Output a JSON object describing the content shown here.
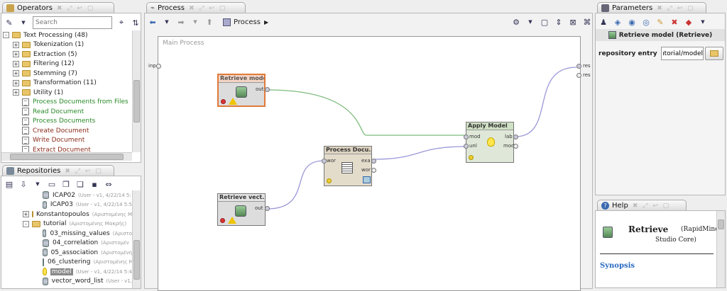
{
  "operators_panel": {
    "tab_label": "Operators",
    "search_placeholder": "Search",
    "tree": [
      {
        "label": "Text Processing (48)",
        "kind": "folder",
        "expander": "-"
      },
      {
        "label": "Tokenization (1)",
        "kind": "folder",
        "expander": "+"
      },
      {
        "label": "Extraction (5)",
        "kind": "folder",
        "expander": "+"
      },
      {
        "label": "Filtering (12)",
        "kind": "folder",
        "expander": "+"
      },
      {
        "label": "Stemming (7)",
        "kind": "folder",
        "expander": "+"
      },
      {
        "label": "Transformation (11)",
        "kind": "folder",
        "expander": "+"
      },
      {
        "label": "Utility (1)",
        "kind": "folder",
        "expander": "+"
      },
      {
        "label": "Process Documents from Files",
        "kind": "op-green"
      },
      {
        "label": "Read Document",
        "kind": "op-green"
      },
      {
        "label": "Process Documents",
        "kind": "op-green"
      },
      {
        "label": "Create Document",
        "kind": "op-brown"
      },
      {
        "label": "Write Document",
        "kind": "op-brown"
      },
      {
        "label": "Extract Document",
        "kind": "op-brown"
      }
    ]
  },
  "repositories_panel": {
    "tab_label": "Repositories",
    "tree": [
      {
        "label": "ICAP02",
        "sub": "(User - v1, 4/22/14 5:",
        "kind": "db"
      },
      {
        "label": "ICAP03",
        "sub": "(User - v1, 4/22/14 5:5",
        "kind": "db"
      },
      {
        "label": "Konstantopoulos",
        "sub": "(Αριστομένης Μ",
        "kind": "folder",
        "expander": "+"
      },
      {
        "label": "tutorial",
        "sub": "(Αριστομένης Μακρής)",
        "kind": "folder",
        "expander": "-"
      },
      {
        "label": "03_missing_values",
        "sub": "(Αριστο",
        "kind": "db"
      },
      {
        "label": "04_correlation",
        "sub": "(Αριστομέν",
        "kind": "db"
      },
      {
        "label": "05_association",
        "sub": "(Αριστομένη",
        "kind": "db"
      },
      {
        "label": "06_clustering",
        "sub": "(Αριστομένης Μ",
        "kind": "db"
      },
      {
        "label": "model",
        "sub": "(User - v1, 4/22/14 5:4",
        "kind": "bulb",
        "selected": true
      },
      {
        "label": "vector_word_list",
        "sub": "(User - v1,",
        "kind": "db"
      }
    ]
  },
  "process_panel": {
    "tab_label": "Process",
    "breadcrumb": "Process",
    "canvas_title": "Main Process",
    "left_port": "inp",
    "right_ports": [
      "res",
      "res"
    ],
    "operators": {
      "retrieve_model": {
        "title": "Retrieve model",
        "out": "out"
      },
      "retrieve_vect": {
        "title": "Retrieve vect...",
        "out": "out"
      },
      "process_docs": {
        "title": "Process Docu...",
        "in": "wor",
        "out1": "exa",
        "out2": "wor"
      },
      "apply_model": {
        "title": "Apply Model",
        "in1": "mod",
        "in2": "unl",
        "out1": "lab",
        "out2": "mod"
      }
    }
  },
  "parameters_panel": {
    "tab_label": "Parameters",
    "operator_title": "Retrieve model (Retrieve)",
    "param_label": "repository entry",
    "param_value": "tutorial/model"
  },
  "help_panel": {
    "tab_label": "Help",
    "op_name": "Retrieve",
    "op_source": "(RapidMiner",
    "op_source2": "Studio Core)",
    "section": "Synopsis"
  },
  "colors": {
    "link_green": "#7cba7c",
    "link_purple": "#9a98d8",
    "selected_border": "#e07a3a"
  }
}
